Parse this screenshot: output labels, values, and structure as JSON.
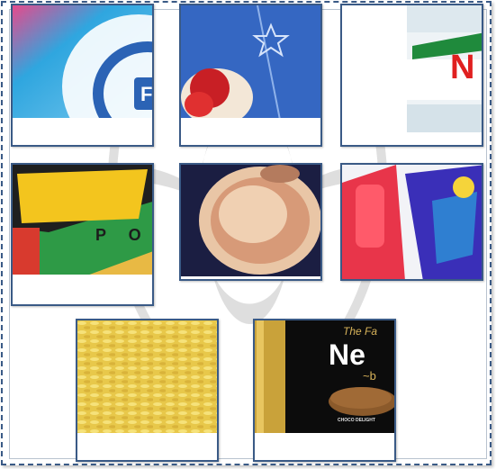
{
  "colors": {
    "frame_border": "#3a5a86",
    "tile_border": "#3a5a86",
    "background": "#ffffff"
  },
  "tiles": [
    {
      "id": "tile-1",
      "subject": "snack-package-logo",
      "texts": {
        "fragment": "F"
      }
    },
    {
      "id": "tile-2",
      "subject": "blue-snack-package-star"
    },
    {
      "id": "tile-3",
      "subject": "mineral-water-bottle",
      "texts": {
        "fragment": "N"
      }
    },
    {
      "id": "tile-4",
      "subject": "chips-package",
      "texts": {
        "fragment": "P O"
      }
    },
    {
      "id": "tile-5",
      "subject": "dried-shrimp-snack"
    },
    {
      "id": "tile-6",
      "subject": "candy-package"
    },
    {
      "id": "tile-7",
      "subject": "yellow-rice-grains"
    },
    {
      "id": "tile-8",
      "subject": "chocolate-package",
      "texts": {
        "brand_top": "The Fa",
        "brand": "Ne",
        "sub": "~b",
        "flavor": "CHOCO DELIGHT"
      }
    }
  ]
}
